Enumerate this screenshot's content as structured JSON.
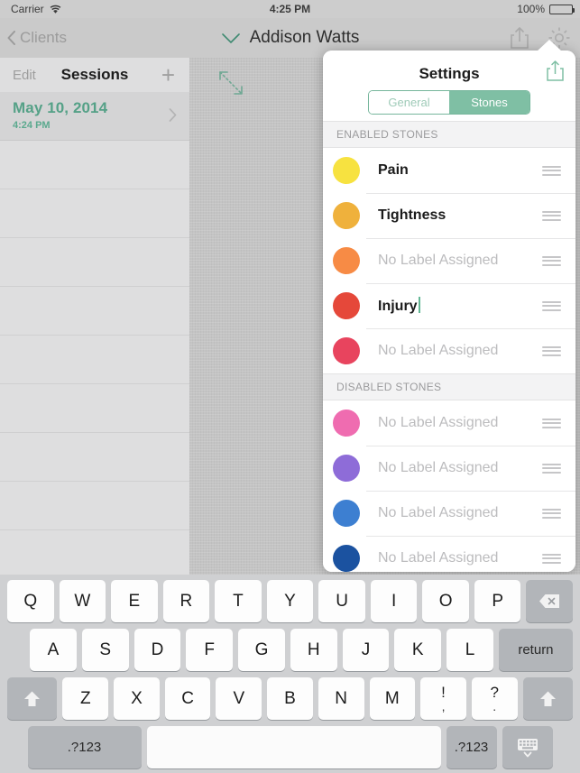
{
  "status_bar": {
    "carrier": "Carrier",
    "wifi_icon": "wifi-icon",
    "time": "4:25 PM",
    "battery_percent": "100%",
    "battery_icon": "battery-icon"
  },
  "nav_bar": {
    "back_label": "Clients",
    "back_icon": "chevron-left-icon",
    "title_caret_icon": "chevron-down-icon",
    "title": "Addison Watts",
    "share_icon": "share-icon",
    "gear_icon": "gear-icon"
  },
  "sidebar": {
    "edit_label": "Edit",
    "title": "Sessions",
    "add_label": "+",
    "sessions": [
      {
        "date": "May 10, 2014",
        "time": "4:24 PM",
        "chevron_icon": "chevron-right-icon"
      }
    ],
    "empty_row_count": 9
  },
  "canvas": {
    "expand_icon": "expand-arrows-icon",
    "caret_icon": "chevron-down-icon"
  },
  "popover": {
    "title": "Settings",
    "share_icon": "share-icon",
    "segmented": {
      "options": [
        "General",
        "Stones"
      ],
      "selected": "Stones",
      "accent_color": "#7fbfa4"
    },
    "sections": [
      {
        "heading": "ENABLED STONES",
        "rows": [
          {
            "color": "#f7e240",
            "label": "Pain",
            "assigned": true,
            "editing": false,
            "handle_icon": "reorder-handle-icon"
          },
          {
            "color": "#efb13c",
            "label": "Tightness",
            "assigned": true,
            "editing": false,
            "handle_icon": "reorder-handle-icon"
          },
          {
            "color": "#f78b45",
            "label": "No Label Assigned",
            "assigned": false,
            "editing": false,
            "handle_icon": "reorder-handle-icon"
          },
          {
            "color": "#e5483a",
            "label": "Injury",
            "assigned": true,
            "editing": true,
            "handle_icon": "reorder-handle-icon"
          },
          {
            "color": "#e8445e",
            "label": "No Label Assigned",
            "assigned": false,
            "editing": false,
            "handle_icon": "reorder-handle-icon"
          }
        ]
      },
      {
        "heading": "DISABLED STONES",
        "rows": [
          {
            "color": "#ef6cb0",
            "label": "No Label Assigned",
            "assigned": false,
            "editing": false,
            "handle_icon": "reorder-handle-icon"
          },
          {
            "color": "#8e6cd8",
            "label": "No Label Assigned",
            "assigned": false,
            "editing": false,
            "handle_icon": "reorder-handle-icon"
          },
          {
            "color": "#3d7fd1",
            "label": "No Label Assigned",
            "assigned": false,
            "editing": false,
            "handle_icon": "reorder-handle-icon"
          },
          {
            "color": "#1b52a0",
            "label": "No Label Assigned",
            "assigned": false,
            "editing": false,
            "handle_icon": "reorder-handle-icon"
          }
        ]
      }
    ]
  },
  "keyboard": {
    "row1": [
      "Q",
      "W",
      "E",
      "R",
      "T",
      "Y",
      "U",
      "I",
      "O",
      "P"
    ],
    "backspace_icon": "backspace-icon",
    "row2": [
      "A",
      "S",
      "D",
      "F",
      "G",
      "H",
      "J",
      "K",
      "L"
    ],
    "return_label": "return",
    "row3": [
      "Z",
      "X",
      "C",
      "V",
      "B",
      "N",
      "M"
    ],
    "punct_keys": [
      {
        "top": "!",
        "bottom": ","
      },
      {
        "top": "?",
        "bottom": "."
      }
    ],
    "shift_icon": "shift-arrow-icon",
    "numeric_label_left": ".?123",
    "numeric_label_right": ".?123",
    "space_label": "",
    "dismiss_icon": "keyboard-dismiss-icon"
  }
}
